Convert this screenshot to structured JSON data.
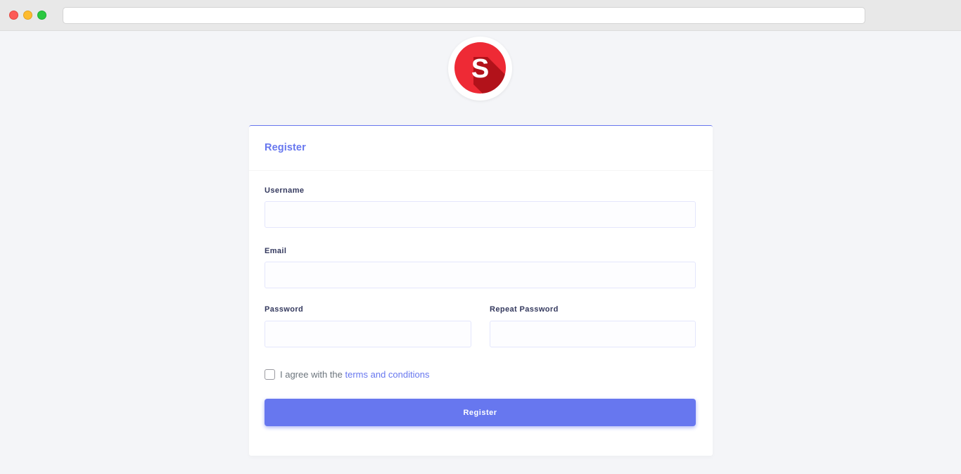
{
  "logo": {
    "letter": "S",
    "color": "#ed1c24"
  },
  "card": {
    "title": "Register",
    "fields": {
      "username": {
        "label": "Username",
        "value": ""
      },
      "email": {
        "label": "Email",
        "value": ""
      },
      "password": {
        "label": "Password",
        "value": ""
      },
      "repeat_password": {
        "label": "Repeat Password",
        "value": ""
      }
    },
    "agree": {
      "prefix": "I agree with the",
      "link": "terms and conditions",
      "checked": false
    },
    "submit_label": "Register"
  },
  "colors": {
    "accent": "#6777ef",
    "page_bg": "#f4f5f8"
  }
}
